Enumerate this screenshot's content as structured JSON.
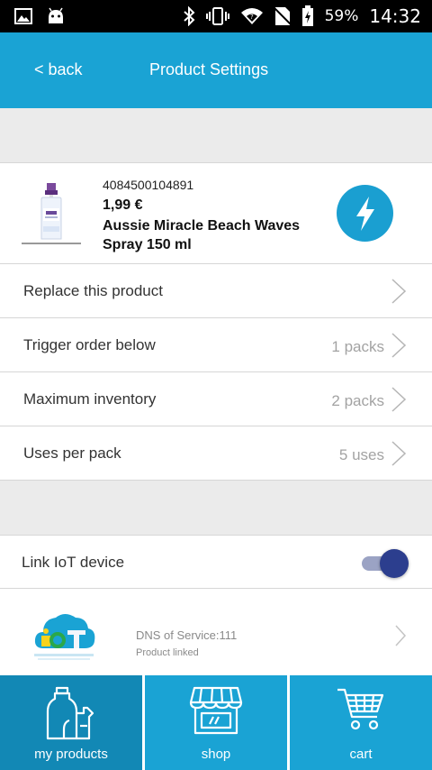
{
  "status_bar": {
    "battery": "59%",
    "time": "14:32",
    "icons": [
      "image-icon",
      "android-icon",
      "bluetooth-icon",
      "vibrate-icon",
      "wifi-icon",
      "no-sim-icon",
      "battery-icon"
    ]
  },
  "header": {
    "back_label": "< back",
    "title": "Product Settings"
  },
  "product": {
    "ean": "4084500104891",
    "price": "1,99 €",
    "name": "Aussie Miracle Beach Waves Spray 150 ml",
    "image": "spray-bottle-image",
    "action_icon": "lightning-icon",
    "action_color": "#1a9fd1"
  },
  "settings": [
    {
      "label": "Replace this product",
      "value": ""
    },
    {
      "label": "Trigger order below",
      "value": "1 packs"
    },
    {
      "label": "Maximum inventory",
      "value": "2 packs"
    },
    {
      "label": "Uses per pack",
      "value": "5 uses"
    }
  ],
  "iot": {
    "toggle_label": "Link IoT device",
    "toggle_on": true,
    "toggle_color": "#2c3e8e"
  },
  "device": {
    "logo_icon": "iot-cloud-icon",
    "name": "DNS of Service:111",
    "status": "Product linked"
  },
  "bottom_nav": [
    {
      "label": "my products",
      "icon": "products-icon",
      "active": true
    },
    {
      "label": "shop",
      "icon": "shop-icon",
      "active": false
    },
    {
      "label": "cart",
      "icon": "cart-icon",
      "active": false
    }
  ],
  "colors": {
    "primary": "#1aa3d4",
    "primary_active": "#1288b5",
    "background": "#ebebeb"
  }
}
